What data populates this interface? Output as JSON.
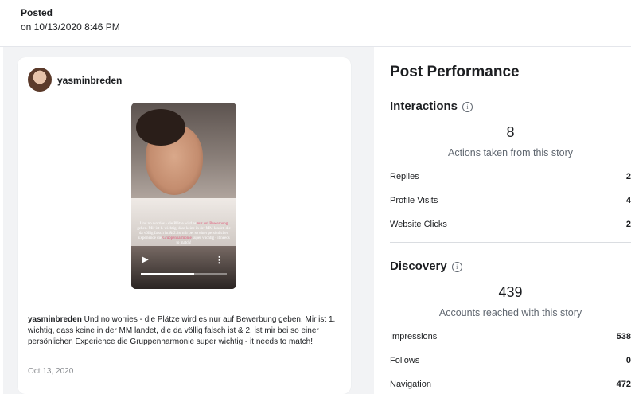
{
  "posted": {
    "label": "Posted",
    "date": "on 10/13/2020 8:46 PM"
  },
  "post": {
    "username": "yasminbreden",
    "story_overlay": {
      "line1a": "Und no worries - die Plätze wird es ",
      "line1b": "nur auf Bewerbung",
      "line1c": " geben.",
      "line2": "Mir ist 1. wichtig, dass keine in der MM landet, die da völlig falsch ist & 2. ist mir bei so einer persönlichen Experience die",
      "line2b": "Gruppenharmonie",
      "line2c": " super wichtig - it needs to match!"
    },
    "progress": 0.62,
    "caption_user": "yasminbreden",
    "caption_text": " Und no worries - die Plätze wird es nur auf Bewerbung geben. Mir ist 1. wichtig, dass keine in der MM landet, die da völlig falsch ist & 2. ist mir bei so einer persönlichen Experience die Gruppenharmonie super wichtig - it needs to match!",
    "date": "Oct 13, 2020"
  },
  "performance": {
    "title": "Post Performance",
    "interactions": {
      "title": "Interactions",
      "value": "8",
      "subtitle": "Actions taken from this story",
      "rows": [
        {
          "label": "Replies",
          "value": "2"
        },
        {
          "label": "Profile Visits",
          "value": "4"
        },
        {
          "label": "Website Clicks",
          "value": "2"
        }
      ]
    },
    "discovery": {
      "title": "Discovery",
      "value": "439",
      "subtitle": "Accounts reached with this story",
      "rows": [
        {
          "label": "Impressions",
          "value": "538"
        },
        {
          "label": "Follows",
          "value": "0"
        },
        {
          "label": "Navigation",
          "value": "472"
        }
      ]
    }
  },
  "icons": {
    "info": "info-icon",
    "play": "play-icon",
    "more": "more-vertical-icon"
  }
}
